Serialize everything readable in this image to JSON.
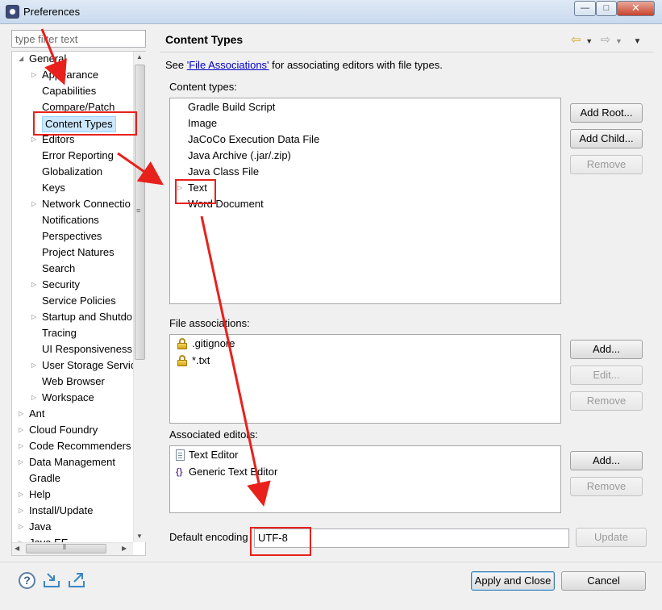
{
  "window": {
    "title": "Preferences",
    "minimize": "—",
    "maximize": "□",
    "close": "✕"
  },
  "filter": {
    "placeholder": "type filter text",
    "value": ""
  },
  "tree": {
    "items": [
      {
        "label": "General",
        "level": 0,
        "expandable": true,
        "expanded": true
      },
      {
        "label": "Appearance",
        "level": 1,
        "expandable": true
      },
      {
        "label": "Capabilities",
        "level": 1,
        "expandable": false
      },
      {
        "label": "Compare/Patch",
        "level": 1,
        "expandable": false
      },
      {
        "label": "Content Types",
        "level": 1,
        "expandable": false,
        "selected": true
      },
      {
        "label": "Editors",
        "level": 1,
        "expandable": true
      },
      {
        "label": "Error Reporting",
        "level": 1,
        "expandable": false
      },
      {
        "label": "Globalization",
        "level": 1,
        "expandable": false
      },
      {
        "label": "Keys",
        "level": 1,
        "expandable": false
      },
      {
        "label": "Network Connectio",
        "level": 1,
        "expandable": true
      },
      {
        "label": "Notifications",
        "level": 1,
        "expandable": false
      },
      {
        "label": "Perspectives",
        "level": 1,
        "expandable": false
      },
      {
        "label": "Project Natures",
        "level": 1,
        "expandable": false
      },
      {
        "label": "Search",
        "level": 1,
        "expandable": false
      },
      {
        "label": "Security",
        "level": 1,
        "expandable": true
      },
      {
        "label": "Service Policies",
        "level": 1,
        "expandable": false
      },
      {
        "label": "Startup and Shutdo",
        "level": 1,
        "expandable": true
      },
      {
        "label": "Tracing",
        "level": 1,
        "expandable": false
      },
      {
        "label": "UI Responsiveness",
        "level": 1,
        "expandable": false
      },
      {
        "label": "User Storage Servic",
        "level": 1,
        "expandable": true
      },
      {
        "label": "Web Browser",
        "level": 1,
        "expandable": false
      },
      {
        "label": "Workspace",
        "level": 1,
        "expandable": true
      },
      {
        "label": "Ant",
        "level": 0,
        "expandable": true
      },
      {
        "label": "Cloud Foundry",
        "level": 0,
        "expandable": true
      },
      {
        "label": "Code Recommenders",
        "level": 0,
        "expandable": true
      },
      {
        "label": "Data Management",
        "level": 0,
        "expandable": true
      },
      {
        "label": "Gradle",
        "level": 0,
        "expandable": false
      },
      {
        "label": "Help",
        "level": 0,
        "expandable": true
      },
      {
        "label": "Install/Update",
        "level": 0,
        "expandable": true
      },
      {
        "label": "Java",
        "level": 0,
        "expandable": true
      },
      {
        "label": "Java EE",
        "level": 0,
        "expandable": true
      }
    ]
  },
  "page": {
    "title": "Content Types",
    "description_prefix": "See ",
    "description_link": "'File Associations'",
    "description_suffix": " for associating editors with file types."
  },
  "content_types": {
    "label": "Content types:",
    "items": [
      {
        "label": "Gradle Build Script",
        "expandable": false
      },
      {
        "label": "Image",
        "expandable": false
      },
      {
        "label": "JaCoCo Execution Data File",
        "expandable": false
      },
      {
        "label": "Java Archive (.jar/.zip)",
        "expandable": false
      },
      {
        "label": "Java Class File",
        "expandable": false
      },
      {
        "label": "Text",
        "expandable": true
      },
      {
        "label": "Word Document",
        "expandable": false
      }
    ],
    "buttons": {
      "add_root": "Add Root...",
      "add_child": "Add Child...",
      "remove": "Remove"
    }
  },
  "file_associations": {
    "label": "File associations:",
    "items": [
      {
        "label": ".gitignore",
        "icon": "lock-icon"
      },
      {
        "label": "*.txt",
        "icon": "lock-icon"
      }
    ],
    "buttons": {
      "add": "Add...",
      "edit": "Edit...",
      "remove": "Remove"
    }
  },
  "associated_editors": {
    "label": "Associated editors:",
    "items": [
      {
        "label": "Text Editor",
        "icon": "document-icon"
      },
      {
        "label": "Generic Text Editor",
        "icon": "generic-editor-icon"
      }
    ],
    "buttons": {
      "add": "Add...",
      "remove": "Remove"
    }
  },
  "encoding": {
    "label": "Default encoding",
    "value": "UTF-8",
    "update_button": "Update"
  },
  "footer": {
    "help_glyph": "?",
    "apply_close": "Apply and Close",
    "cancel": "Cancel"
  },
  "colors": {
    "annotation": "#e8211c",
    "selection": "#cce8ff",
    "link": "#0000cc"
  }
}
